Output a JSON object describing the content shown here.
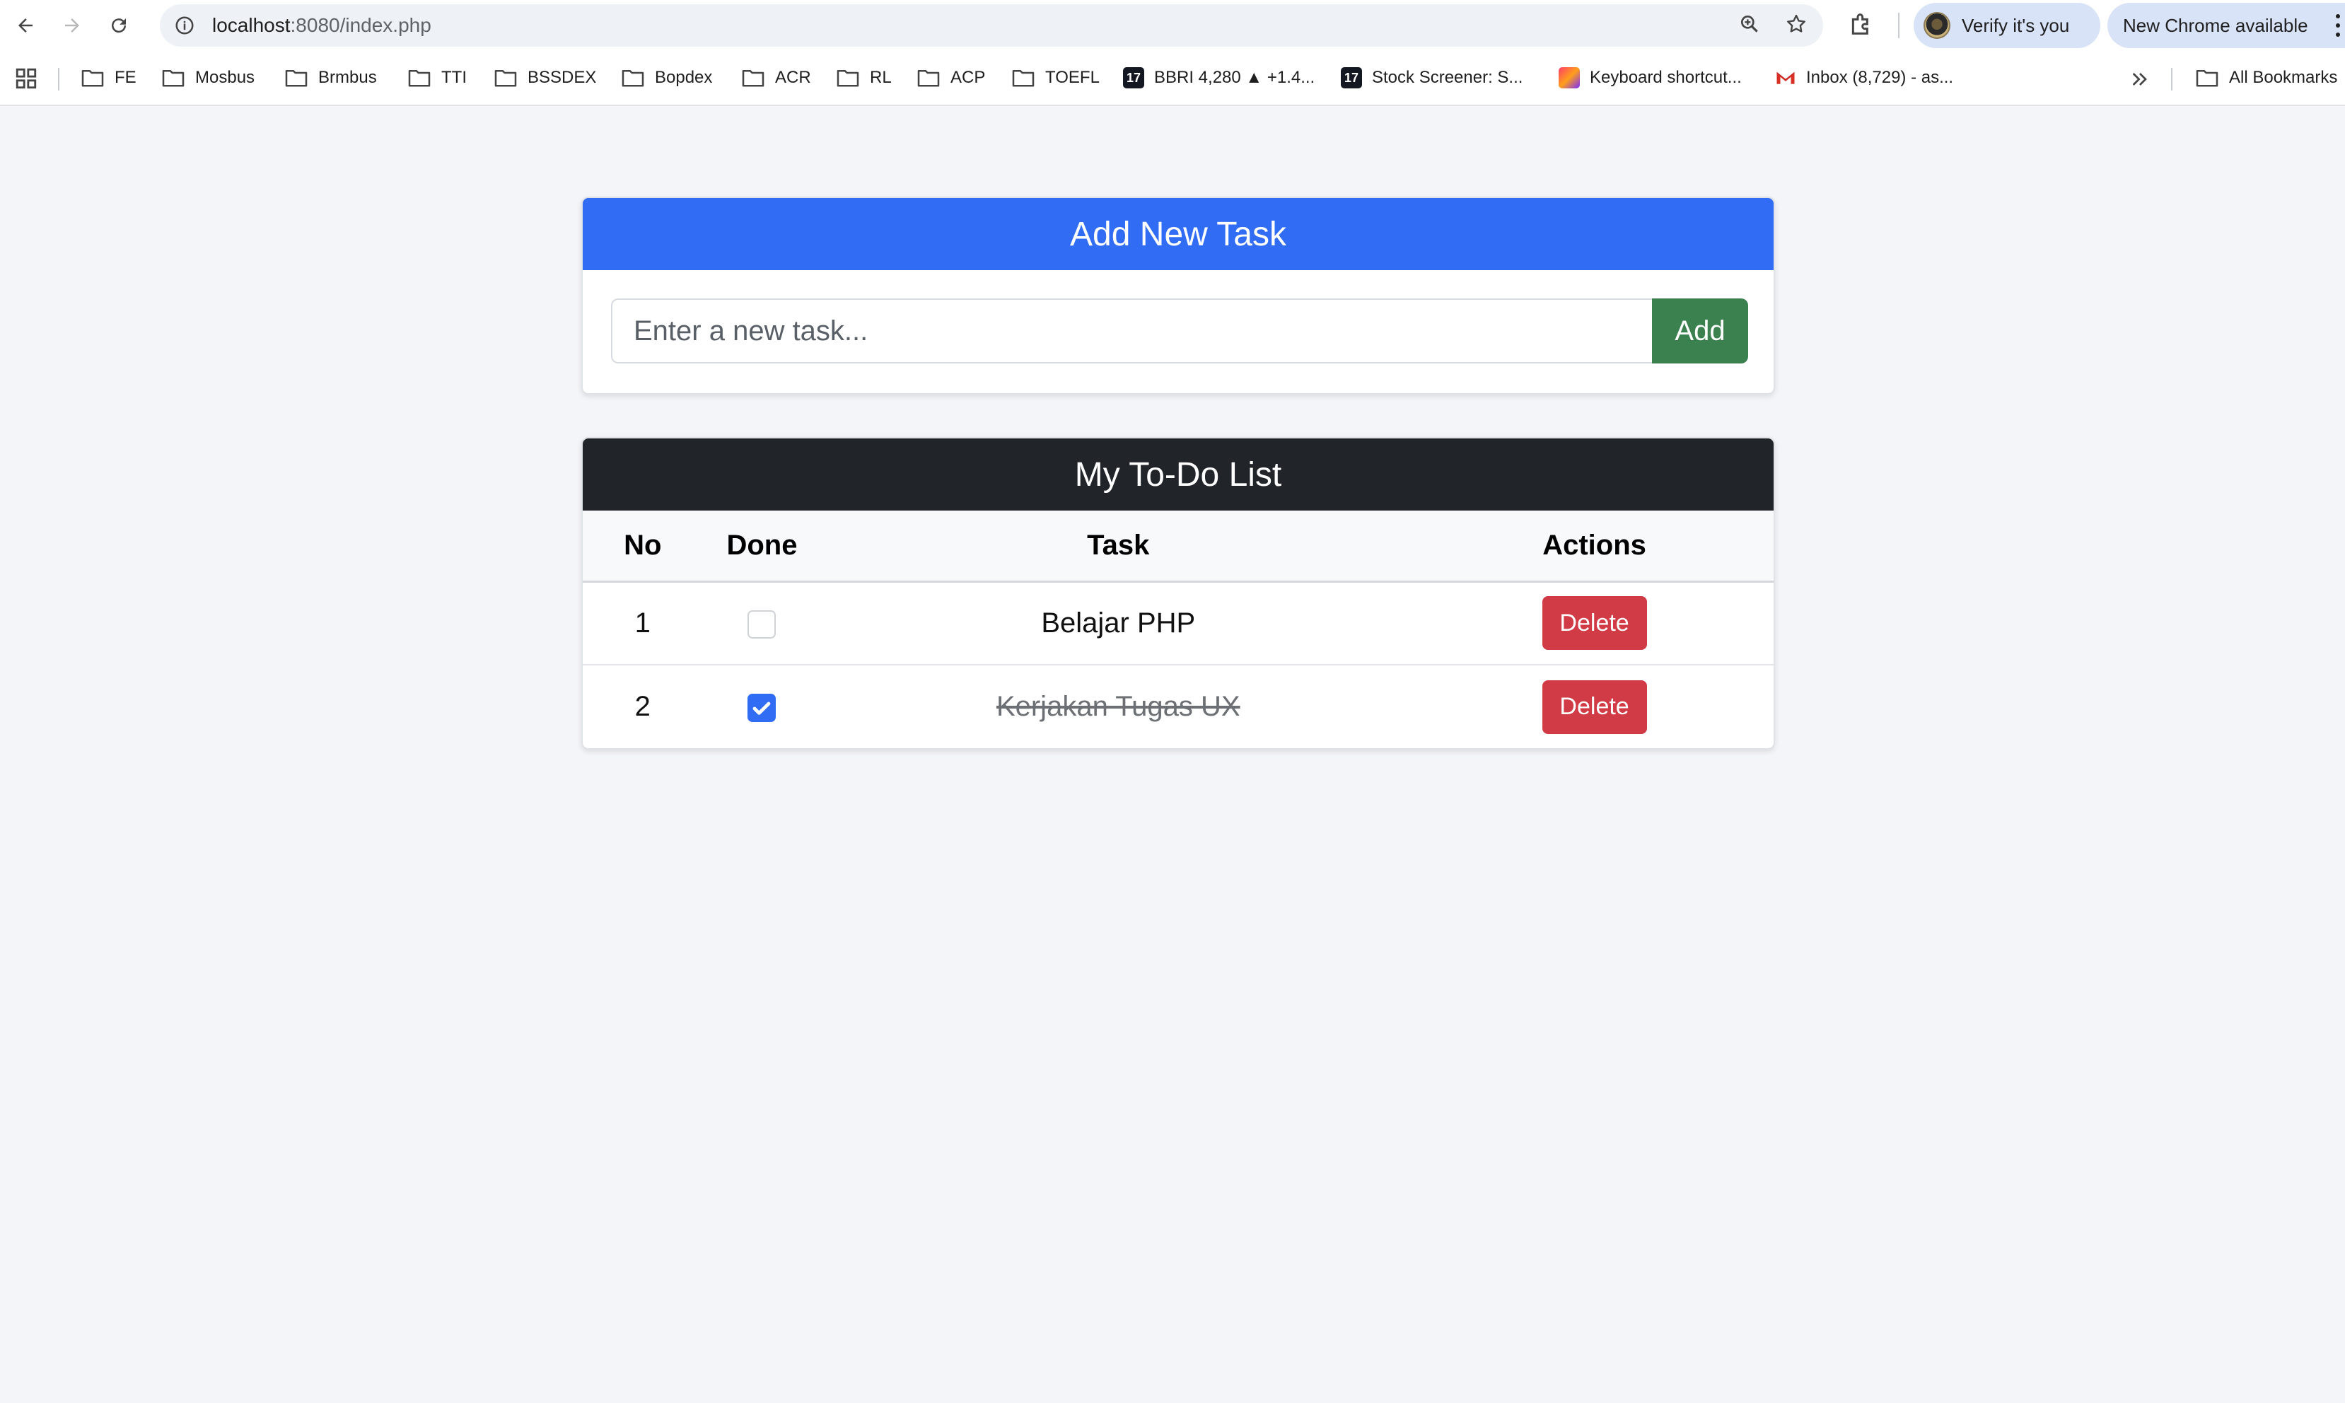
{
  "browser": {
    "url_host": "localhost",
    "url_path": ":8080/index.php",
    "verify_label": "Verify it's you",
    "update_label": "New Chrome available"
  },
  "bookmarks": [
    {
      "label": "FE",
      "icon": "folder-icon"
    },
    {
      "label": "Mosbus",
      "icon": "folder-icon"
    },
    {
      "label": "Brmbus",
      "icon": "folder-icon"
    },
    {
      "label": "TTI",
      "icon": "folder-icon"
    },
    {
      "label": "BSSDEX",
      "icon": "folder-icon"
    },
    {
      "label": "Bopdex",
      "icon": "folder-icon"
    },
    {
      "label": "ACR",
      "icon": "folder-icon"
    },
    {
      "label": "RL",
      "icon": "folder-icon"
    },
    {
      "label": "ACP",
      "icon": "folder-icon"
    },
    {
      "label": "TOEFL",
      "icon": "folder-icon"
    },
    {
      "label": "BBRI 4,280 ▲ +1.4...",
      "icon": "tradingview-icon"
    },
    {
      "label": "Stock Screener: S...",
      "icon": "tradingview-icon"
    },
    {
      "label": "Keyboard shortcut...",
      "icon": "shortcut-app-icon"
    },
    {
      "label": "Inbox (8,729) - as...",
      "icon": "gmail-icon"
    }
  ],
  "all_bookmarks_label": "All Bookmarks",
  "add_card": {
    "title": "Add New Task",
    "input_placeholder": "Enter a new task...",
    "input_value": "",
    "add_label": "Add"
  },
  "list_card": {
    "title": "My To-Do List",
    "headers": {
      "no": "No",
      "done": "Done",
      "task": "Task",
      "actions": "Actions"
    },
    "rows": [
      {
        "no": "1",
        "done": false,
        "task": "Belajar PHP",
        "delete_label": "Delete"
      },
      {
        "no": "2",
        "done": true,
        "task": "Kerjakan Tugas UX",
        "delete_label": "Delete"
      }
    ]
  },
  "colors": {
    "primary": "#316cf4",
    "dark_header": "#212529",
    "success": "#3b8150",
    "danger": "#d03b45",
    "page_bg": "#f4f5f8"
  }
}
